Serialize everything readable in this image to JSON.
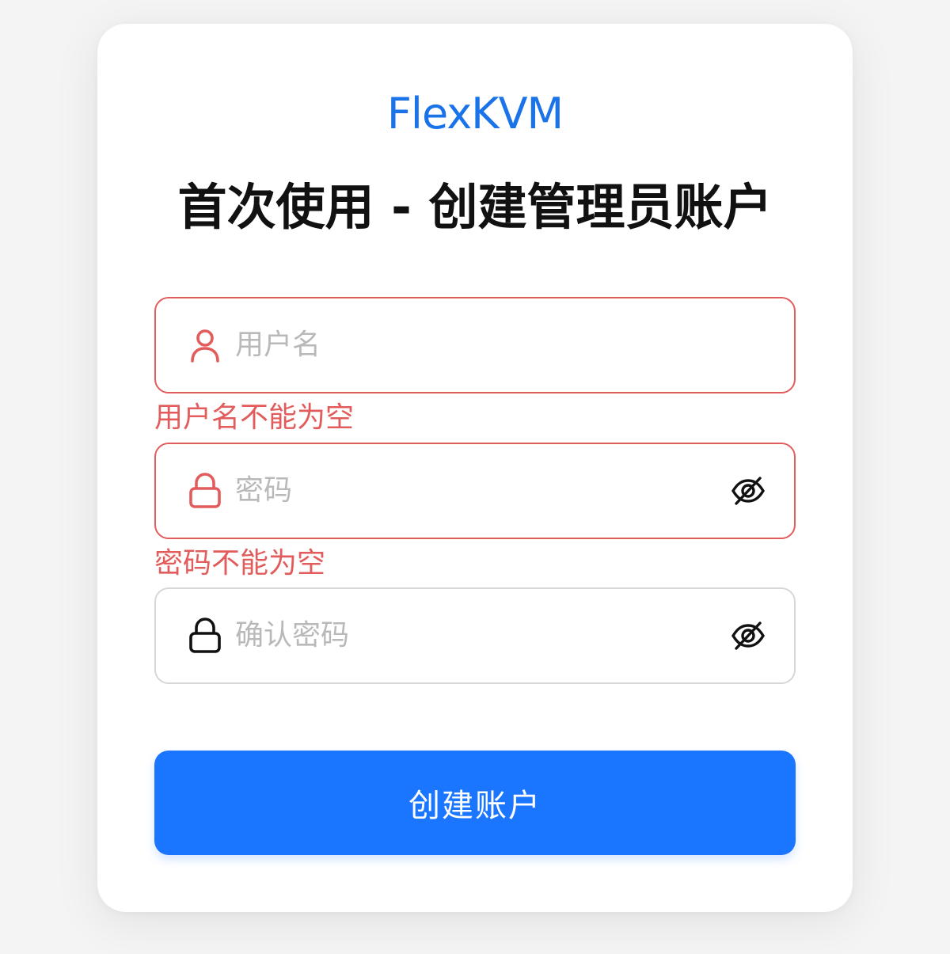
{
  "brand": "FlexKVM",
  "title": "首次使用 - 创建管理员账户",
  "form": {
    "username": {
      "placeholder": "用户名",
      "error": "用户名不能为空",
      "icon": "user-icon"
    },
    "password": {
      "placeholder": "密码",
      "error": "密码不能为空",
      "icon": "lock-icon",
      "toggle_icon": "eye-off-icon"
    },
    "confirm_password": {
      "placeholder": "确认密码",
      "icon": "lock-icon",
      "toggle_icon": "eye-off-icon"
    },
    "submit_label": "创建账户"
  },
  "colors": {
    "accent": "#1a76ff",
    "brand": "#1a73e8",
    "error": "#e25c5c",
    "border": "#d7d7d7",
    "placeholder": "#b9b9b9"
  }
}
